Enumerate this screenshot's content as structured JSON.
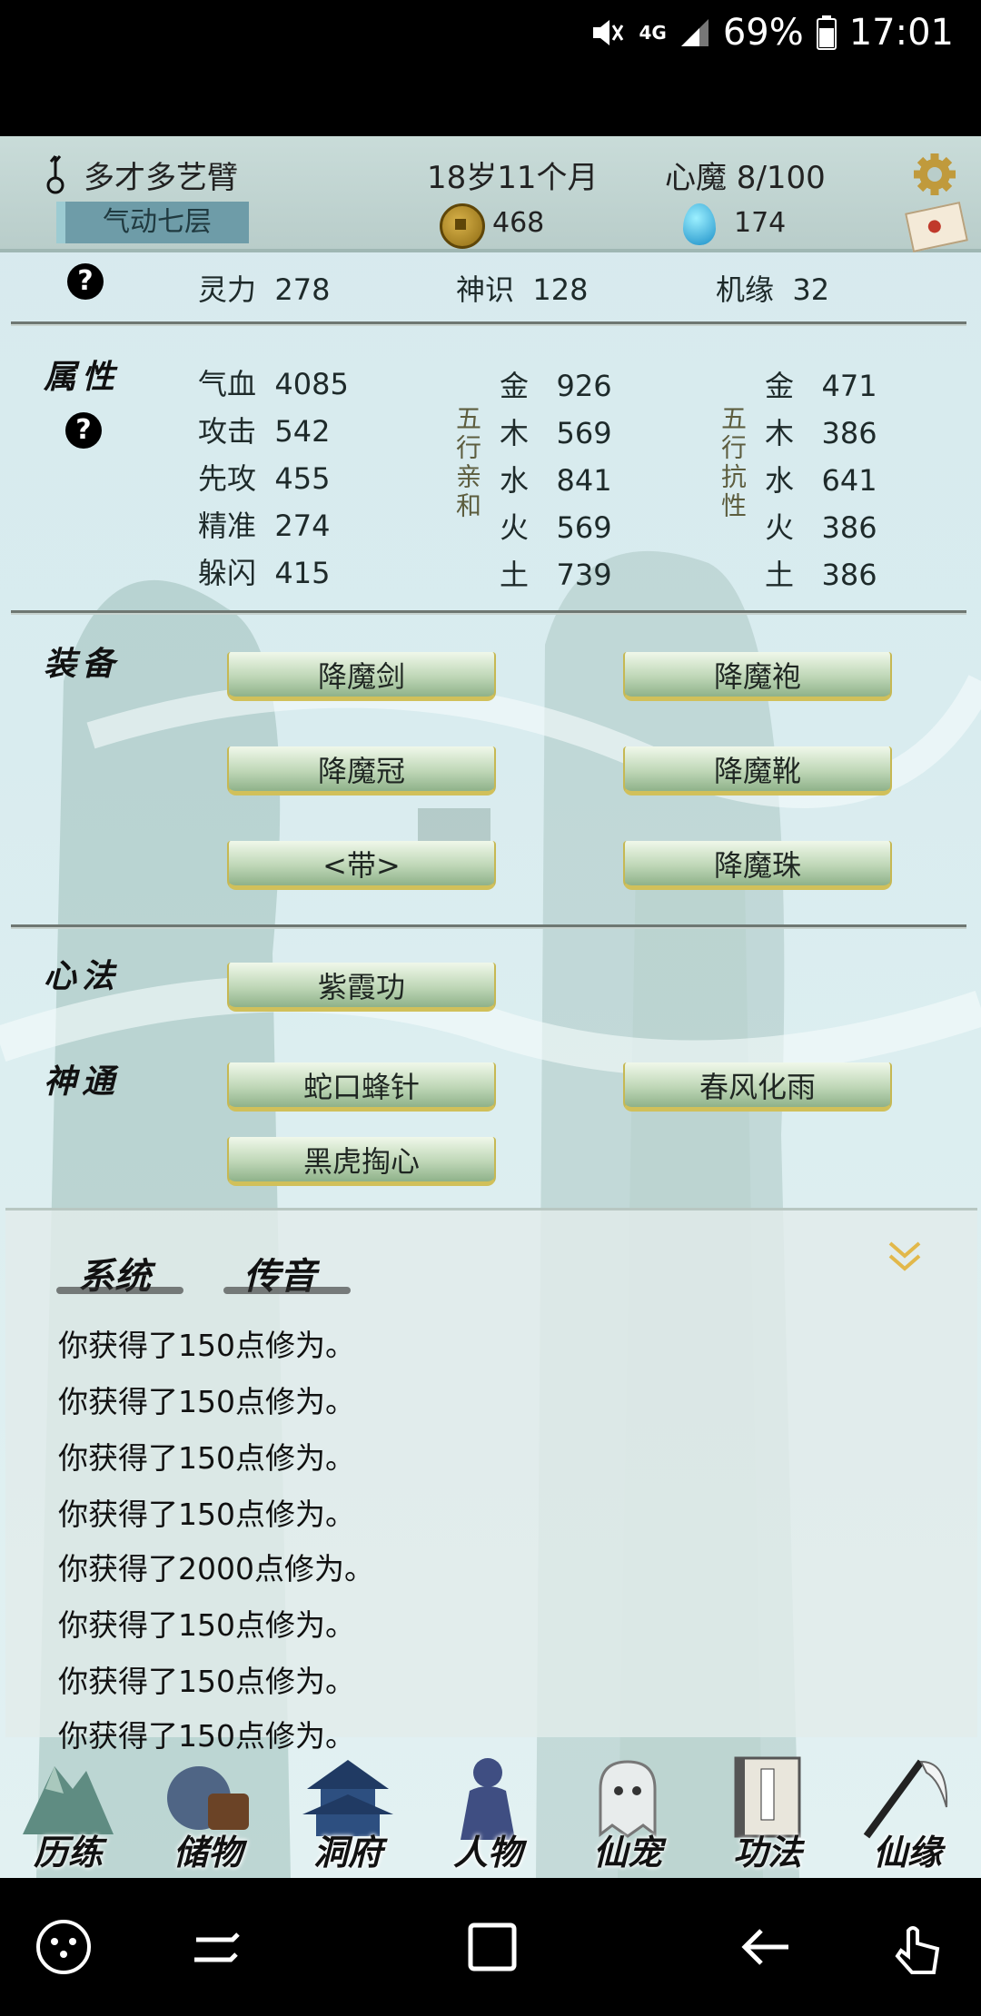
{
  "status_bar": {
    "network": "4G",
    "battery": "69%",
    "time": "17:01"
  },
  "header": {
    "player_name": "多才多艺臂",
    "realm": "气动七层",
    "age": "18岁11个月",
    "heart_demon": "心魔 8/100",
    "coins": "468",
    "gems": "174"
  },
  "stats_row": [
    {
      "label": "灵力",
      "value": "278"
    },
    {
      "label": "神识",
      "value": "128"
    },
    {
      "label": "机缘",
      "value": "32"
    }
  ],
  "attributes": {
    "title": "属性",
    "basic": [
      {
        "label": "气血",
        "value": "4085"
      },
      {
        "label": "攻击",
        "value": "542"
      },
      {
        "label": "先攻",
        "value": "455"
      },
      {
        "label": "精准",
        "value": "274"
      },
      {
        "label": "躲闪",
        "value": "415"
      }
    ],
    "affinity_title": "五行亲和",
    "affinity": [
      {
        "label": "金",
        "value": "926"
      },
      {
        "label": "木",
        "value": "569"
      },
      {
        "label": "水",
        "value": "841"
      },
      {
        "label": "火",
        "value": "569"
      },
      {
        "label": "土",
        "value": "739"
      }
    ],
    "resist_title": "五行抗性",
    "resist": [
      {
        "label": "金",
        "value": "471"
      },
      {
        "label": "木",
        "value": "386"
      },
      {
        "label": "水",
        "value": "641"
      },
      {
        "label": "火",
        "value": "386"
      },
      {
        "label": "土",
        "value": "386"
      }
    ]
  },
  "equipment": {
    "title": "装备",
    "items": [
      "降魔剑",
      "降魔袍",
      "降魔冠",
      "降魔靴",
      "<带>",
      "降魔珠"
    ]
  },
  "mind_method": {
    "title": "心法",
    "items": [
      "紫霞功"
    ]
  },
  "divine_powers": {
    "title": "神通",
    "items": [
      "蛇口蜂针",
      "春风化雨",
      "黑虎掏心"
    ]
  },
  "chat": {
    "tabs": [
      "系统",
      "传音"
    ],
    "messages": [
      "你获得了150点修为。",
      "你获得了150点修为。",
      "你获得了150点修为。",
      "你获得了150点修为。",
      "你获得了2000点修为。",
      "你获得了150点修为。",
      "你获得了150点修为。",
      "你获得了150点修为。"
    ]
  },
  "nav": [
    "历练",
    "储物",
    "洞府",
    "人物",
    "仙宠",
    "功法",
    "仙缘"
  ],
  "colors": {
    "button_trim": "#d1c05a",
    "collapse_arrow": "#e2b84a"
  }
}
